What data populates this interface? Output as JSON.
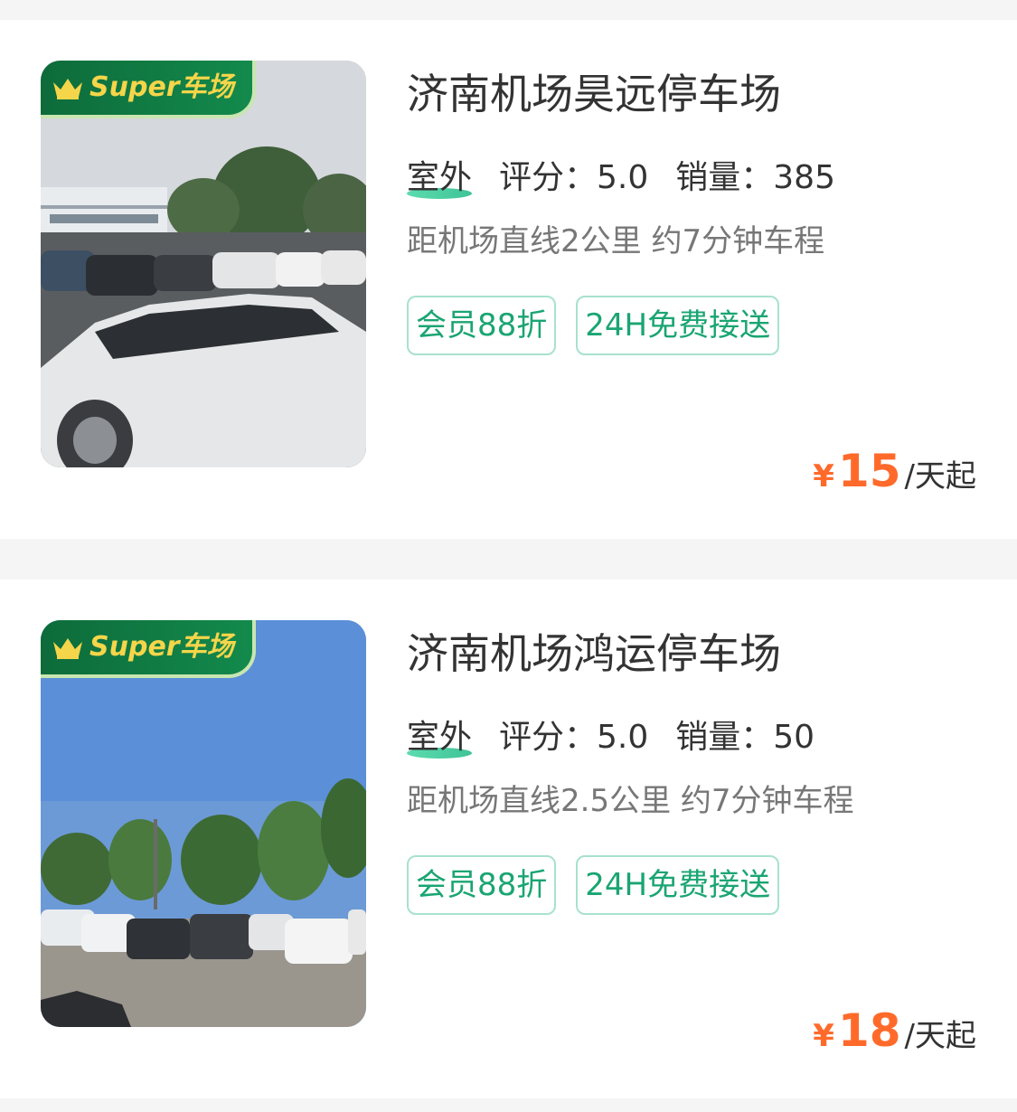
{
  "lots": [
    {
      "badge": "Super车场",
      "name": "济南机场昊远停车场",
      "type": "室外",
      "rating": "评分：5.0",
      "sales": "销量：385",
      "distance": "距机场直线2公里 约7分钟车程",
      "tags": [
        "会员88折",
        "24H免费接送"
      ],
      "price": {
        "currency": "¥",
        "amount": "15",
        "unit": "/天起"
      },
      "photo": "parking-lot-white-sedan"
    },
    {
      "badge": "Super车场",
      "name": "济南机场鸿运停车场",
      "type": "室外",
      "rating": "评分：5.0",
      "sales": "销量：50",
      "distance": "距机场直线2.5公里 约7分钟车程",
      "tags": [
        "会员88折",
        "24H免费接送"
      ],
      "price": {
        "currency": "¥",
        "amount": "18",
        "unit": "/天起"
      },
      "photo": "parking-lot-blue-sky"
    }
  ],
  "colors": {
    "accent_green": "#1aa572",
    "badge_green": "#0d6b3a",
    "price_orange": "#ff6a2b",
    "text_dark": "#333333",
    "text_gray": "#777777"
  }
}
